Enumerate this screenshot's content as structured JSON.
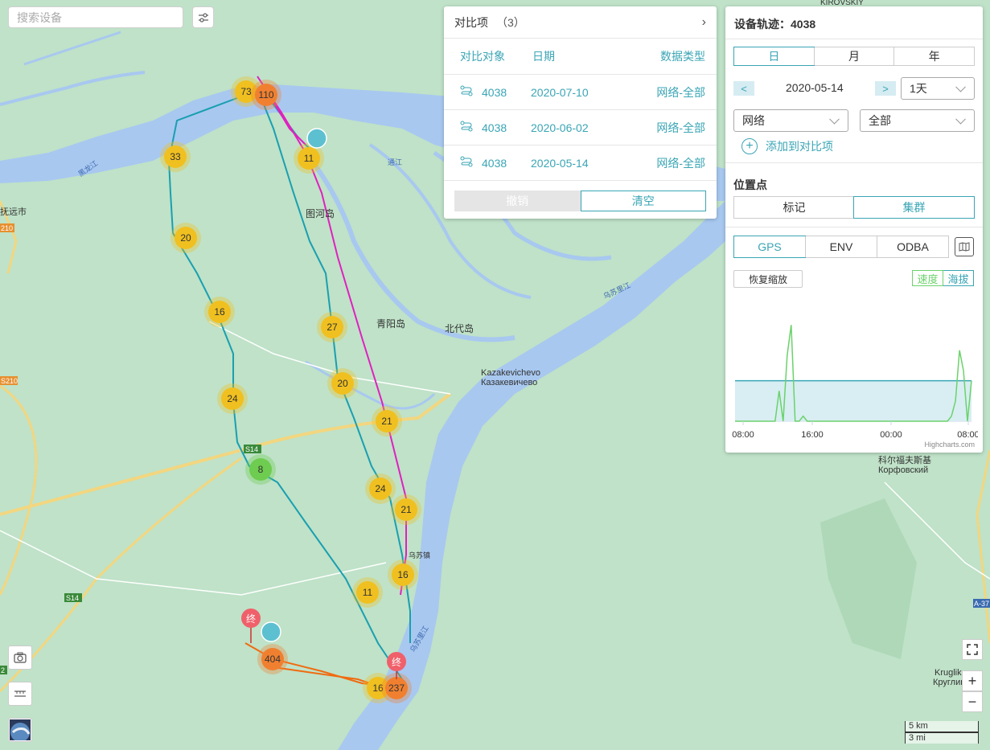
{
  "search": {
    "placeholder": "搜索设备"
  },
  "map": {
    "place_labels": [
      {
        "text": "图河岛"
      },
      {
        "text": "青阳岛"
      },
      {
        "text": "北代岛"
      },
      {
        "text": "Kazakevichevo"
      },
      {
        "text": "Казакевичево"
      },
      {
        "text": "科尔福夫斯基"
      },
      {
        "text": "Корфовский"
      },
      {
        "text": "抚远市"
      },
      {
        "text": "Kruglikovo"
      },
      {
        "text": "Кругликово"
      },
      {
        "text": "KIROVSKIY"
      },
      {
        "text": "乌苏镇"
      }
    ],
    "river_labels": [
      "黑龙江",
      "通江",
      "乌苏里江",
      "乌苏里江"
    ],
    "road_labels": [
      "S14",
      "S14",
      "S210",
      "S210",
      "210",
      "A-37",
      "2"
    ],
    "clusters": [
      {
        "label": "73",
        "color": "#f0c020"
      },
      {
        "label": "110",
        "color": "#f08030"
      },
      {
        "label": "11",
        "color": "#f0c020"
      },
      {
        "label": "33",
        "color": "#f0c020"
      },
      {
        "label": "20",
        "color": "#f0c020"
      },
      {
        "label": "16",
        "color": "#f0c020"
      },
      {
        "label": "27",
        "color": "#f0c020"
      },
      {
        "label": "20",
        "color": "#f0c020"
      },
      {
        "label": "24",
        "color": "#f0c020"
      },
      {
        "label": "21",
        "color": "#f0c020"
      },
      {
        "label": "8",
        "color": "#6ecc50"
      },
      {
        "label": "24",
        "color": "#f0c020"
      },
      {
        "label": "21",
        "color": "#f0c020"
      },
      {
        "label": "16",
        "color": "#f0c020"
      },
      {
        "label": "11",
        "color": "#f0c020"
      },
      {
        "label": "404",
        "color": "#f08030"
      },
      {
        "label": "16",
        "color": "#f0c020"
      },
      {
        "label": "237",
        "color": "#f08030"
      }
    ],
    "end_marker_label": "终",
    "scale": {
      "km": "5 km",
      "mi": "3 mi"
    }
  },
  "compare": {
    "title": "对比项",
    "count": "（3）",
    "columns": [
      "对比对象",
      "日期",
      "数据类型"
    ],
    "rows": [
      {
        "device": "4038",
        "date": "2020-07-10",
        "type": "网络-全部"
      },
      {
        "device": "4038",
        "date": "2020-06-02",
        "type": "网络-全部"
      },
      {
        "device": "4038",
        "date": "2020-05-14",
        "type": "网络-全部"
      }
    ],
    "undo_label": "撤销",
    "clear_label": "清空"
  },
  "panel": {
    "title": "设备轨迹：4038",
    "period_tabs": [
      "日",
      "月",
      "年"
    ],
    "date": "2020-05-14",
    "prev": "<",
    "next": ">",
    "range": "1天",
    "source": "网络",
    "filter": "全部",
    "add_compare": "添加到对比项",
    "points_title": "位置点",
    "points_tabs": [
      "标记",
      "集群"
    ],
    "sensor_tabs": [
      "GPS",
      "ENV",
      "ODBA"
    ],
    "reset_zoom": "恢复缩放",
    "metric_speed": "速度",
    "metric_alt": "海拔",
    "credit": "Highcharts.com"
  },
  "chart_data": {
    "type": "area",
    "x_ticks": [
      "08:00",
      "16:00",
      "00:00",
      "08:00"
    ],
    "series": [
      {
        "name": "海拔",
        "color": "#3aa5b5",
        "values": [
          40,
          40,
          40,
          40,
          40,
          40,
          40,
          40,
          40,
          40,
          40,
          40,
          40,
          40,
          40,
          40,
          40,
          40,
          40,
          40,
          40,
          40,
          40,
          40,
          40,
          40,
          40,
          40,
          40,
          40,
          40,
          40,
          40,
          40,
          40,
          40,
          40,
          40,
          40,
          40,
          40,
          40,
          40,
          40,
          40,
          40,
          40,
          40,
          40,
          40,
          40,
          40,
          40,
          40,
          40,
          40,
          40,
          40,
          40,
          40
        ]
      },
      {
        "name": "速度",
        "color": "#6bd26b",
        "values": [
          0,
          0,
          0,
          0,
          0,
          0,
          0,
          0,
          0,
          0,
          0,
          30,
          0,
          65,
          95,
          0,
          0,
          5,
          0,
          0,
          0,
          0,
          0,
          0,
          0,
          0,
          0,
          0,
          0,
          0,
          0,
          0,
          0,
          0,
          0,
          0,
          0,
          0,
          0,
          0,
          0,
          0,
          0,
          0,
          0,
          0,
          0,
          0,
          0,
          0,
          0,
          0,
          0,
          0,
          5,
          20,
          70,
          50,
          0,
          40
        ]
      }
    ]
  }
}
